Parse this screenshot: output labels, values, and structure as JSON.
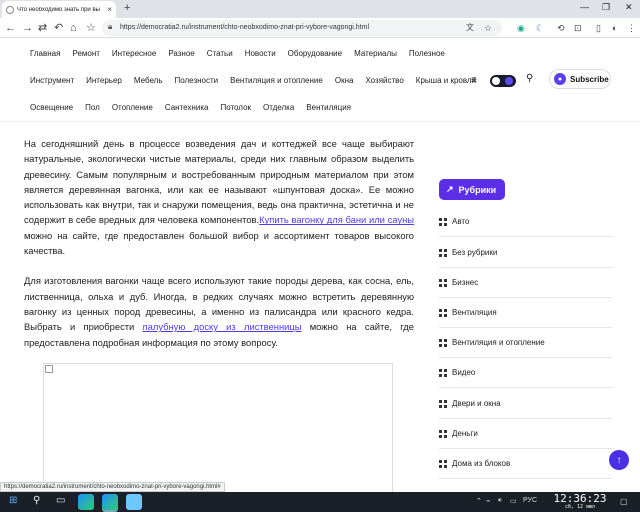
{
  "browser": {
    "tab_title": "Что необходимо знать при вы",
    "tab_close": "×",
    "new_tab": "+",
    "url": "https://democratia2.ru/instrument/chto-neobxodimo-znat-pri-vybore-vagongi.html",
    "status_url": "https://democratia2.ru/instrument/chto-neobxodimo-znat-pri-vybore-vagongi.html#"
  },
  "site_nav": {
    "row1": [
      "Главная",
      "Ремонт",
      "Интересное",
      "Разное",
      "Статьи",
      "Новости",
      "Оборудование",
      "Материалы",
      "Полезное"
    ],
    "row2": [
      "Инструмент",
      "Интерьер",
      "Мебель",
      "Полезности",
      "Вентиляция и отопление",
      "Окна",
      "Хозяйство",
      "Крыша и кровля"
    ],
    "row3": [
      "Освещение",
      "Пол",
      "Отопление",
      "Сантехника",
      "Потолок",
      "Отделка",
      "Вентиляция"
    ],
    "subscribe_label": "Subscribe"
  },
  "article": {
    "p1_text": "На сегодняшний день в процессе возведения дач и коттеджей все чаще выбирают натуральные, экологически чистые материалы, среди них главным образом выделить древесину. Самым популярным и востребованным природным материалом при этом является деревянная вагонка, или как ее называют «шпунтовая доска». Ее можно использовать как внутри, так и снаружи помещения, ведь она практична, эстетична и не содержит в себе вредных для человека компонентов.",
    "p1_link": "Купить вагонку для бани или сауны",
    "p1_after": " можно на сайте, где предоставлен большой вибор и ассортимент товаров высокого качества.",
    "p2_text": "Для изготовления вагонки чаще всего используют такие породы дерева, как сосна, ель, лиственница, ольха и дуб. Иногда, в редких случаях можно встретить деревянную вагонку из ценных пород древесины, а именно из палисандра или красного кедра. Выбрать и приобрести ",
    "p2_link": "палубную доску из лиственницы",
    "p2_after": " можно на сайте, где предоставлена подробная информация по этому вопросу."
  },
  "sidebar": {
    "rubrics_label": "Рубрики",
    "categories": [
      "Авто",
      "Без рубрики",
      "Бизнес",
      "Вентиляция",
      "Вентиляция и отопление",
      "Видео",
      "Двери и окна",
      "Деньги",
      "Дома из блоков"
    ]
  },
  "taskbar": {
    "lang": "РУС",
    "time": "12:36:23",
    "date": "сб, 12 июл"
  },
  "colors": {
    "accent": "#5b2ee8",
    "link": "#4b3cf0",
    "taskbar": "#1b1f27"
  }
}
